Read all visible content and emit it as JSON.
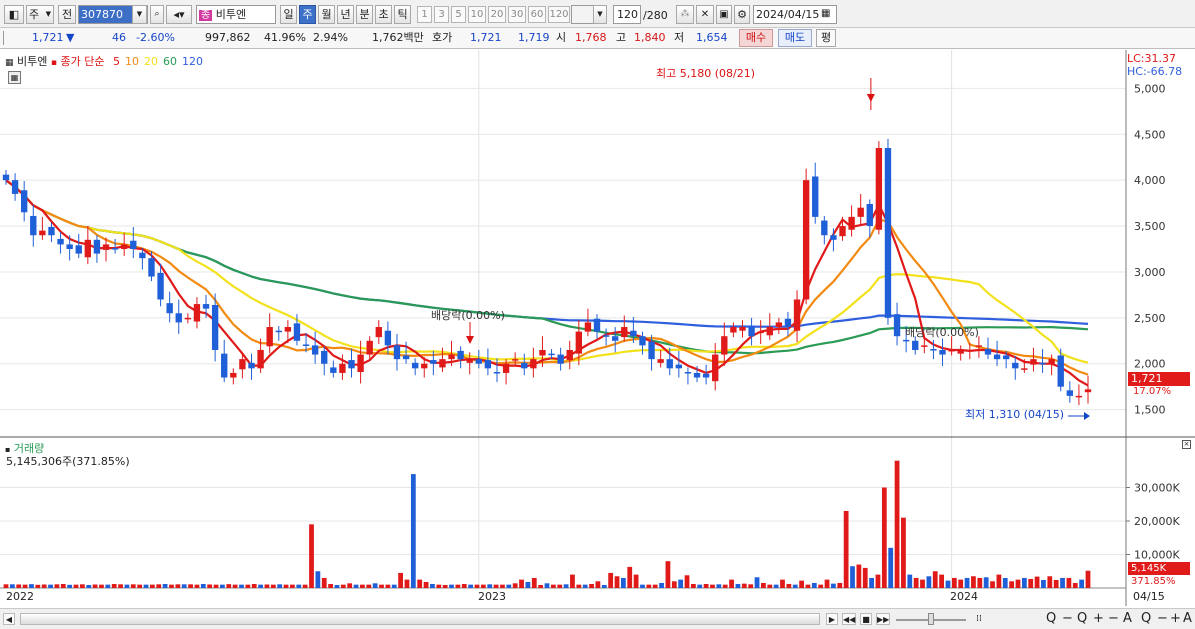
{
  "toolbar": {
    "type_select": "주",
    "prev_label": "전",
    "stock_code": "307870",
    "stock_name": "비투엔",
    "stock_badge": "종",
    "periods": [
      {
        "label": "일",
        "active": false
      },
      {
        "label": "주",
        "active": true
      },
      {
        "label": "월",
        "active": false
      },
      {
        "label": "년",
        "active": false
      },
      {
        "label": "분",
        "active": false
      },
      {
        "label": "초",
        "active": false
      },
      {
        "label": "틱",
        "active": false
      }
    ],
    "intervals": [
      "1",
      "3",
      "5",
      "10",
      "20",
      "30",
      "60",
      "120"
    ],
    "count": "120",
    "total": "/280",
    "date": "2024/04/15"
  },
  "quote": {
    "price": "1,721",
    "direction": "▼",
    "change": "46",
    "change_pct": "-2.60%",
    "volume": "997,862",
    "volume_ratio": "41.96%",
    "turnover": "2.94%",
    "amount": "1,762백만",
    "bid_label": "호가",
    "ask": "1,721",
    "bid": "1,719",
    "open_label": "시",
    "open": "1,768",
    "high_label": "고",
    "high": "1,840",
    "low_label": "저",
    "low": "1,654",
    "buy_label": "매수",
    "sell_label": "매도",
    "eval_label": "평"
  },
  "legend": {
    "name": "비투엔",
    "ma_label": "종가 단순",
    "ma": [
      {
        "period": "5",
        "color": "#e01919"
      },
      {
        "period": "10",
        "color": "#f28a12"
      },
      {
        "period": "20",
        "color": "#f2e11b"
      },
      {
        "period": "60",
        "color": "#2a9a55"
      },
      {
        "period": "120",
        "color": "#2f5fdd"
      }
    ]
  },
  "price_panel": {
    "lc": "LC:31.37",
    "hc": "HC:-66.78",
    "y_ticks": [
      "5,000",
      "4,500",
      "4,000",
      "3,500",
      "3,000",
      "2,500",
      "2,000",
      "1,500"
    ],
    "current_price_tag": "1,721",
    "current_pct_tag": "17.07%",
    "high_annotation": "최고 5,180 (08/21)",
    "low_annotation": "최저 1,310 (04/15)",
    "dividend_labels": [
      "배당락(0.00%)",
      "배당락(0.00%)"
    ]
  },
  "volume_panel": {
    "title": "거래량",
    "current": "5,145,306주(371.85%)",
    "y_ticks": [
      "30,000K",
      "20,000K",
      "10,000K"
    ],
    "current_tag": "5,145K",
    "current_pct_tag": "371.85%"
  },
  "x_axis": [
    "2022",
    "2023",
    "2024"
  ],
  "x_axis_right": "04/15",
  "chart_data": {
    "type": "candlestick",
    "weeks": 120,
    "close": [
      4000,
      3850,
      3650,
      3400,
      3450,
      3400,
      3300,
      3250,
      3200,
      3350,
      3200,
      3300,
      3250,
      3300,
      3250,
      3150,
      2950,
      2700,
      2550,
      2450,
      2500,
      2650,
      2600,
      2150,
      1850,
      1900,
      2050,
      1950,
      2150,
      2400,
      2350,
      2400,
      2250,
      2200,
      2100,
      2000,
      1900,
      2000,
      1950,
      2100,
      2250,
      2400,
      2200,
      2050,
      2050,
      1950,
      2000,
      2000,
      2050,
      2100,
      2050,
      2050,
      2000,
      1950,
      1900,
      2000,
      2050,
      1950,
      2050,
      2150,
      2100,
      2000,
      2150,
      2350,
      2450,
      2350,
      2300,
      2250,
      2400,
      2300,
      2200,
      2050,
      2050,
      1950,
      1950,
      1900,
      1850,
      1850,
      2100,
      2300,
      2400,
      2400,
      2300,
      2350,
      2400,
      2450,
      2400,
      2700,
      4000,
      3600,
      3400,
      3350,
      3500,
      3600,
      3700,
      3500,
      4350,
      2500,
      2300,
      2250,
      2150,
      2200,
      2150,
      2100,
      2150,
      2150,
      2150,
      2200,
      2100,
      2050,
      2050,
      1950,
      1950,
      2050,
      2000,
      2050,
      1750,
      1650,
      1650,
      1721
    ],
    "volume_k": [
      1100,
      1100,
      1050,
      1000,
      1150,
      950,
      1050,
      1000,
      1100,
      1200,
      950,
      1000,
      1100,
      900,
      1050,
      1000,
      1000,
      1200,
      1100,
      1000,
      1100,
      1000,
      1000,
      1000,
      1100,
      1200,
      1000,
      1100,
      1100,
      1100,
      1000,
      1200,
      1050,
      1000,
      1000,
      1150,
      1000,
      1000,
      1000,
      1200,
      1000,
      1050,
      1000,
      1100,
      1000,
      1000,
      1000,
      1000,
      19000,
      5000,
      3000,
      1200,
      900,
      1000,
      1400,
      1000,
      1000,
      1000,
      1400,
      1000,
      1000,
      1000,
      4500,
      2500,
      34000,
      2500,
      1800,
      1200,
      1000,
      900,
      1000,
      1000,
      1200,
      1000,
      1000,
      1000,
      1100,
      1000,
      1000,
      1000,
      1400,
      2500,
      1800,
      3000,
      900,
      1400,
      1000,
      1000,
      1100,
      4000,
      1000,
      1000,
      1200,
      2000,
      900,
      4500,
      3500,
      3000,
      6300,
      4000,
      1000,
      1000,
      1000,
      1500,
      8000,
      2000,
      2500,
      3800,
      1200,
      1000,
      1200,
      1000,
      1100,
      1000,
      2500,
      1200,
      1300,
      1100,
      3200,
      1500,
      1000,
      1000,
      2500,
      1200,
      1000,
      2200,
      1000,
      1500,
      1000,
      2500,
      1300,
      1500,
      23000,
      6500,
      7000,
      6000,
      3000,
      4000,
      30000,
      12000,
      38000,
      21000,
      4000,
      3000,
      2500,
      3500,
      5000,
      4000,
      2200,
      3000,
      2500,
      3000,
      3500,
      3000,
      3200,
      2000,
      4000,
      3000,
      2000,
      2500,
      3000,
      2700,
      3400,
      2400,
      3500,
      2400,
      3000,
      3000,
      1500,
      2500,
      5145
    ],
    "y_range": [
      1300,
      5200
    ],
    "volume_range": [
      0,
      40000
    ],
    "legend_position": "top-left"
  }
}
